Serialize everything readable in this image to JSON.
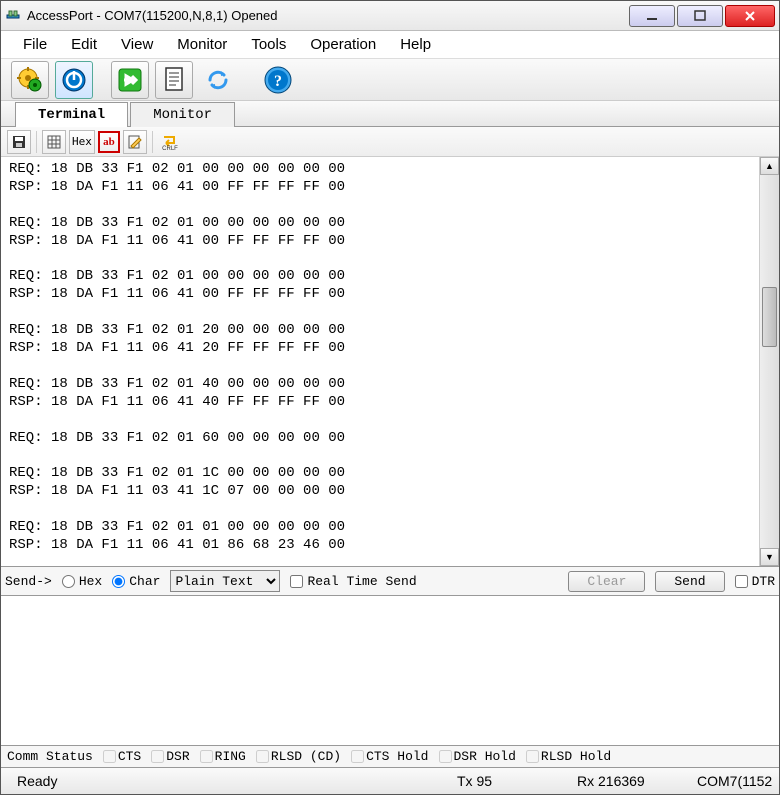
{
  "titlebar": {
    "title": "AccessPort - COM7(115200,N,8,1) Opened"
  },
  "menubar": {
    "items": [
      "File",
      "Edit",
      "View",
      "Monitor",
      "Tools",
      "Operation",
      "Help"
    ]
  },
  "tabs": {
    "terminal": "Terminal",
    "monitor": "Monitor"
  },
  "subtoolbar": {
    "hex_label": "Hex",
    "ab_label": "ab",
    "crlf_label": "CRLF"
  },
  "terminal_output": "REQ: 18 DB 33 F1 02 01 00 00 00 00 00 00\nRSP: 18 DA F1 11 06 41 00 FF FF FF FF 00\n\nREQ: 18 DB 33 F1 02 01 00 00 00 00 00 00\nRSP: 18 DA F1 11 06 41 00 FF FF FF FF 00\n\nREQ: 18 DB 33 F1 02 01 00 00 00 00 00 00\nRSP: 18 DA F1 11 06 41 00 FF FF FF FF 00\n\nREQ: 18 DB 33 F1 02 01 20 00 00 00 00 00\nRSP: 18 DA F1 11 06 41 20 FF FF FF FF 00\n\nREQ: 18 DB 33 F1 02 01 40 00 00 00 00 00\nRSP: 18 DA F1 11 06 41 40 FF FF FF FF 00\n\nREQ: 18 DB 33 F1 02 01 60 00 00 00 00 00\n\nREQ: 18 DB 33 F1 02 01 1C 00 00 00 00 00\nRSP: 18 DA F1 11 03 41 1C 07 00 00 00 00\n\nREQ: 18 DB 33 F1 02 01 01 00 00 00 00 00\nRSP: 18 DA F1 11 06 41 01 86 68 23 46 00",
  "sendbar": {
    "label": "Send->",
    "hex_label": "Hex",
    "char_label": "Char",
    "format_selected": "Plain Text",
    "realtime_label": "Real Time Send",
    "clear_label": "Clear",
    "send_label": "Send",
    "dtr_label": "DTR"
  },
  "commstatus": {
    "label": "Comm Status",
    "flags": [
      "CTS",
      "DSR",
      "RING",
      "RLSD (CD)",
      "CTS Hold",
      "DSR Hold",
      "RLSD Hold"
    ]
  },
  "statusbar": {
    "ready": "Ready",
    "tx": "Tx 95",
    "rx": "Rx 216369",
    "port": "COM7(1152"
  }
}
